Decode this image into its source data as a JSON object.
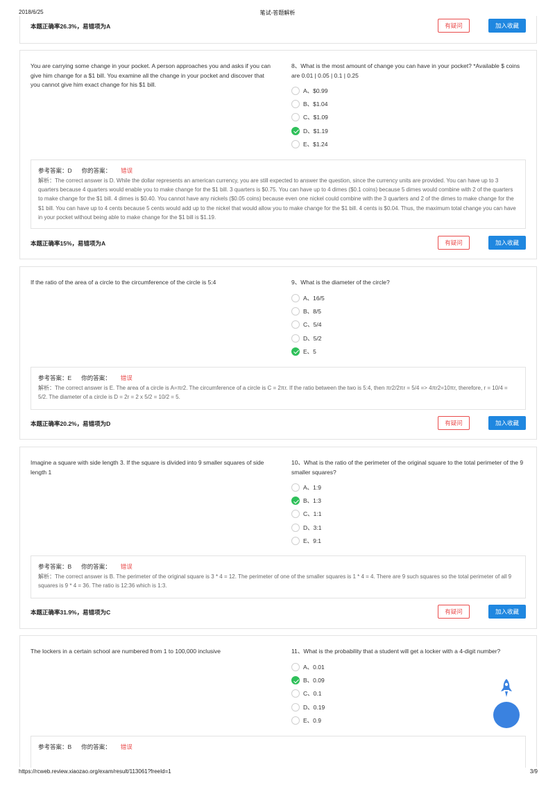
{
  "print": {
    "date": "2018/6/25",
    "title": "笔试-答题解析",
    "url": "https://rcweb.review.xiaozao.org/exam/result/113061?freeId=1",
    "page": "3/9"
  },
  "labels": {
    "doubt": "有疑问",
    "favorite": "加入收藏",
    "ref_answer": "参考答案：",
    "your_answer": "你的答案：",
    "wrong": "错误"
  },
  "colors": {
    "accent": "#1f87e0",
    "error": "#e94b4b",
    "correct": "#2fc05a"
  },
  "top_card": {
    "rate": "本题正确率26.3%，易错项为A"
  },
  "questions": [
    {
      "passage": "You are carrying some change in your pocket. A person approaches you and asks if you can give him change for a $1 bill. You examine all the change in your pocket and discover that you cannot give him exact change for his $1 bill.",
      "question": "8、What is the most amount of change you can have in your pocket? *Available $ coins are 0.01 | 0.05 | 0.1 | 0.25",
      "options": [
        {
          "text": "A、$0.99",
          "checked": false
        },
        {
          "text": "B、$1.04",
          "checked": false
        },
        {
          "text": "C、$1.09",
          "checked": false
        },
        {
          "text": "D、$1.19",
          "checked": true
        },
        {
          "text": "E、$1.24",
          "checked": false
        }
      ],
      "answer": "D",
      "analysis": "解析：The correct answer is D. While the dollar represents an american currency, you are still expected to answer the question, since the currency units are provided. You can have up to 3 quarters because 4 quarters would enable you to make change for the $1 bill. 3 quarters is $0.75. You can have up to 4 dimes ($0.1 coins) because 5 dimes would combine with 2 of the quarters to make change for the $1 bill. 4 dimes is $0.40. You cannot have any nickels ($0.05 coins) because even one nickel could combine with the 3 quarters and 2 of the dimes to make change for the $1 bill. You can have up to 4 cents because 5 cents would add up to the nickel that would allow you to make change for the $1 bill. 4 cents is $0.04. Thus, the maximum total change you can have in your pocket without being able to make change for the $1 bill is $1.19.",
      "rate": "本题正确率15%，易错项为A"
    },
    {
      "passage": "If the ratio of the area of a circle to the circumference of the circle is 5:4",
      "question": "9、What is the diameter of the circle?",
      "options": [
        {
          "text": "A、16/5",
          "checked": false
        },
        {
          "text": "B、8/5",
          "checked": false
        },
        {
          "text": "C、5/4",
          "checked": false
        },
        {
          "text": "D、5/2",
          "checked": false
        },
        {
          "text": "E、5",
          "checked": true
        }
      ],
      "answer": "E",
      "analysis": "解析：The correct answer is E. The area of a circle is A=πr2. The circumference of a circle is C = 2πr. If the ratio between the two is 5:4, then πr2/2πr = 5/4 => 4πr2=10πr, therefore, r = 10/4 = 5/2. The diameter of a circle is D = 2r = 2 x 5/2 = 10/2 = 5.",
      "rate": "本题正确率20.2%，易错项为D"
    },
    {
      "passage": "Imagine a square with side length 3. If the square is divided into 9 smaller squares of side length 1",
      "question": "10、What is the ratio of the perimeter of the original square to the total perimeter of the 9 smaller squares?",
      "options": [
        {
          "text": "A、1:9",
          "checked": false
        },
        {
          "text": "B、1:3",
          "checked": true
        },
        {
          "text": "C、1:1",
          "checked": false
        },
        {
          "text": "D、3:1",
          "checked": false
        },
        {
          "text": "E、9:1",
          "checked": false
        }
      ],
      "answer": "B",
      "analysis": "解析：The correct answer is B. The perimeter of the original square is 3 * 4 = 12. The perimeter of one of the smaller squares is 1 * 4 = 4. There are 9 such squares so the total perimeter of all 9 squares is 9 * 4 = 36. The ratio is 12:36 which is 1:3.",
      "rate": "本题正确率31.9%，易错项为C"
    },
    {
      "passage": "The lockers in a certain school are numbered from 1 to 100,000 inclusive",
      "question": "11、What is the probability that a student will get a locker with a 4-digit number?",
      "options": [
        {
          "text": "A、0.01",
          "checked": false
        },
        {
          "text": "B、0.09",
          "checked": true
        },
        {
          "text": "C、0.1",
          "checked": false
        },
        {
          "text": "D、0.19",
          "checked": false
        },
        {
          "text": "E、0.9",
          "checked": false
        }
      ],
      "answer": "B",
      "analysis": "",
      "rate": ""
    }
  ]
}
